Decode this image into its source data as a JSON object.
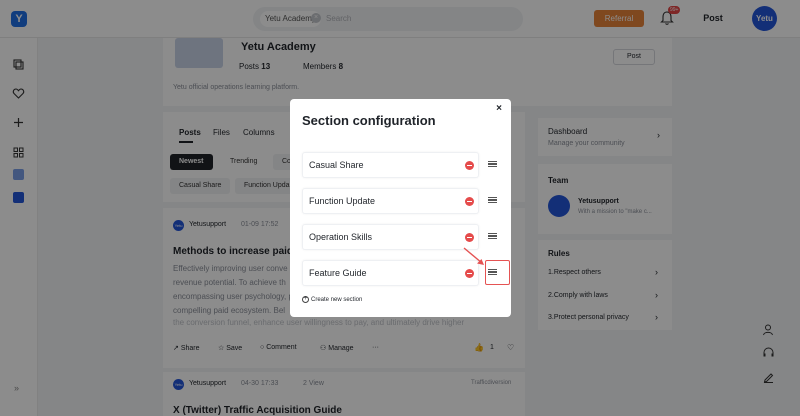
{
  "topbar": {
    "logo_letter": "Y",
    "search_tag": "Yetu Academy",
    "search_placeholder": "Search",
    "referral_label": "Referral",
    "notification_badge": "99+",
    "post_label": "Post",
    "avatar_text": "Yetu"
  },
  "community": {
    "name": "Yetu Academy",
    "posts_label": "Posts",
    "posts_count": "13",
    "members_label": "Members",
    "members_count": "8",
    "post_button": "Post",
    "description": "Yetu official operations learning platform."
  },
  "feed": {
    "tabs": [
      "Posts",
      "Files",
      "Columns"
    ],
    "sort": [
      "Newest",
      "Trending",
      "Co"
    ],
    "filters": [
      "Casual Share",
      "Function Upda"
    ],
    "post1": {
      "author": "Yetusupport",
      "date": "01-09 17:52",
      "title": "Methods to increase paid b",
      "lines": [
        "Effectively improving user conve",
        "revenue potential. To achieve th",
        "encompassing user psychology, p",
        "compelling paid ecosystem. Bel",
        "the conversion funnel, enhance user willingness to pay, and ultimately drive higher"
      ],
      "actions": [
        "Share",
        "Save",
        "Comment",
        "Manage",
        "···"
      ],
      "likes": "1"
    },
    "post2": {
      "author": "Yetusupport",
      "date": "04-30 17:33",
      "views": "2 View",
      "tag": "Trafficdiversion",
      "title": "X (Twitter) Traffic Acquisition Guide"
    }
  },
  "sidebar": {
    "dashboard_title": "Dashboard",
    "dashboard_sub": "Manage your community",
    "team_title": "Team",
    "team_member": "Yetusupport",
    "team_member_sub": "With a mission to \"make c...",
    "rules_title": "Rules",
    "rules": [
      "1.Respect others",
      "2.Comply with laws",
      "3.Protect personal privacy"
    ]
  },
  "modal": {
    "title": "Section configuration",
    "close": "×",
    "sections": [
      "Casual Share",
      "Function Update",
      "Operation Skills",
      "Feature Guide"
    ],
    "create_label": "Create new section"
  },
  "colors": {
    "accent": "#1f6fe5",
    "referral": "#e8833a",
    "danger": "#e54b4b",
    "highlight": "#e55353"
  }
}
